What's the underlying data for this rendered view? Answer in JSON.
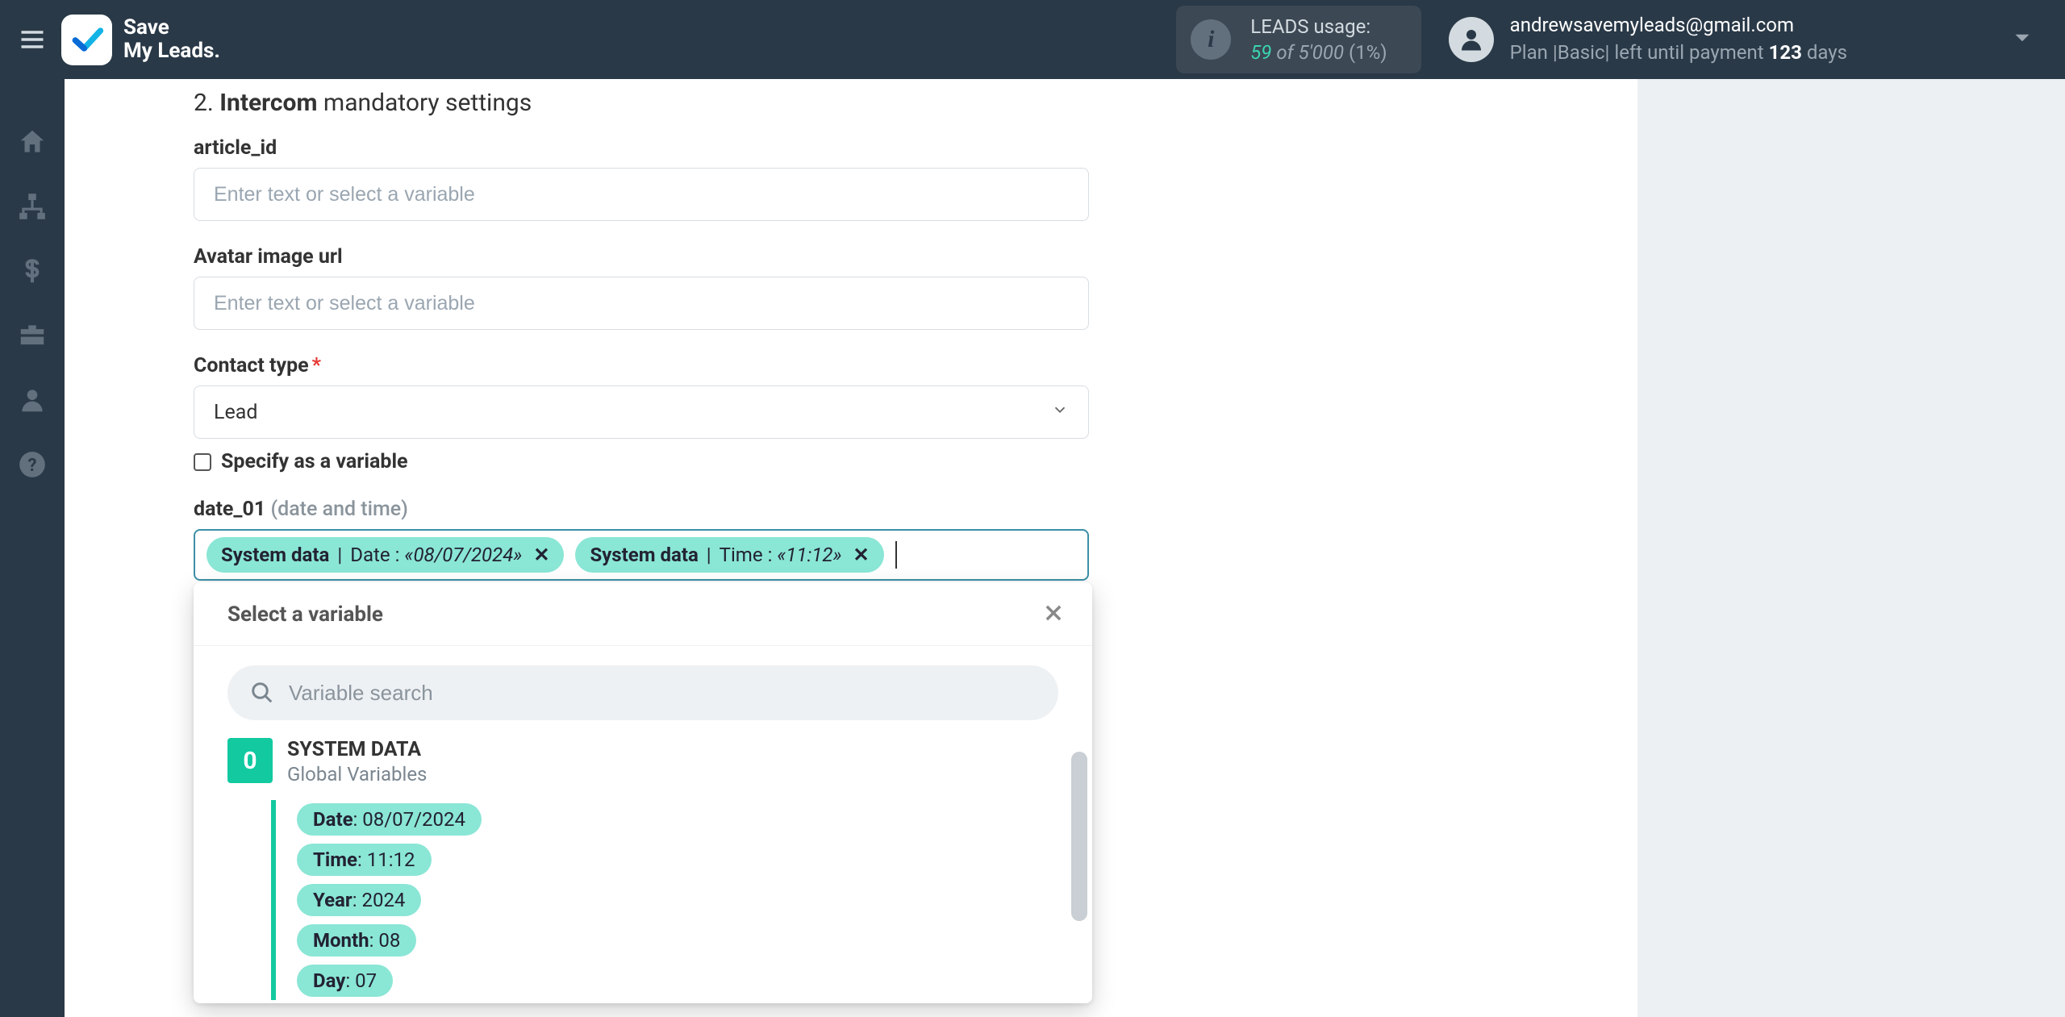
{
  "header": {
    "logo_line1": "Save",
    "logo_line2": "My Leads.",
    "usage_label": "LEADS usage:",
    "usage_current": "59",
    "usage_of": "of",
    "usage_total": "5'000",
    "usage_pct": "(1%)",
    "user_email": "andrewsavemyleads@gmail.com",
    "plan_prefix": "Plan |",
    "plan_name": "Basic",
    "plan_mid": "|  left until payment ",
    "plan_days": "123",
    "plan_suffix": " days"
  },
  "section": {
    "number": "2.",
    "bold": "Intercom",
    "rest": " mandatory settings"
  },
  "fields": {
    "article_id": {
      "label": "article_id",
      "placeholder": "Enter text or select a variable"
    },
    "avatar_url": {
      "label": "Avatar image url",
      "placeholder": "Enter text or select a variable"
    },
    "contact_type": {
      "label": "Contact type",
      "value": "Lead",
      "specify_label": "Specify as a variable"
    },
    "date01": {
      "label": "date_01",
      "hint": "(date and time)"
    }
  },
  "tags": [
    {
      "source": "System data",
      "key": "Date",
      "value": "«08/07/2024»"
    },
    {
      "source": "System data",
      "key": "Time",
      "value": "«11:12»"
    }
  ],
  "dropdown": {
    "title": "Select a variable",
    "search_placeholder": "Variable search",
    "group_badge": "0",
    "group_title": "SYSTEM DATA",
    "group_sub": "Global Variables",
    "vars": [
      {
        "name": "Date",
        "value": "08/07/2024"
      },
      {
        "name": "Time",
        "value": "11:12"
      },
      {
        "name": "Year",
        "value": "2024"
      },
      {
        "name": "Month",
        "value": "08"
      },
      {
        "name": "Day",
        "value": "07"
      }
    ]
  }
}
